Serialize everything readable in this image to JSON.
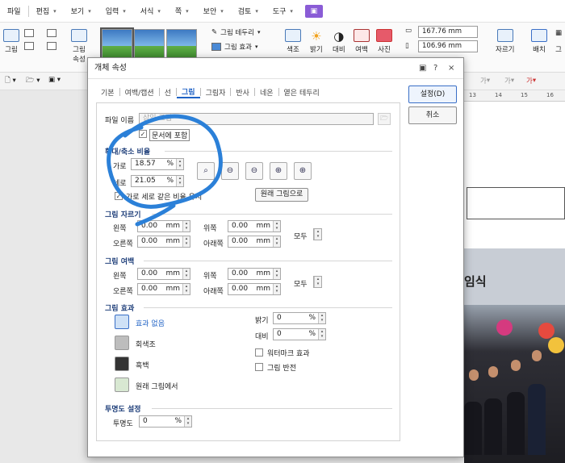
{
  "menubar": {
    "items": [
      "파일",
      "편집",
      "보기",
      "입력",
      "서식",
      "쪽",
      "보안",
      "검토",
      "도구"
    ]
  },
  "ribbon": {
    "picture_label": "그림",
    "picture_label2": "그림",
    "picture_label2_line2": "속성",
    "border_label": "그림 테두리",
    "effect_label": "그림 효과",
    "color_label": "색조",
    "brightness_label": "밝기",
    "contrast_label": "대비",
    "margin_label": "여백",
    "photo_label": "사진",
    "width_value": "167.76",
    "height_value": "106.96",
    "unit": "mm",
    "crop_label": "자르기",
    "arrange_label": "배치",
    "extra_label": "그"
  },
  "toolbar2": {
    "font_label": "가",
    "font_label2": "가",
    "font_label3": "가"
  },
  "doc": {
    "ruler": [
      "13",
      "14",
      "15",
      "16"
    ],
    "photo_title": "임식"
  },
  "dialog": {
    "title": "개체 속성",
    "help": "?",
    "close": "×",
    "tabs": [
      "기본",
      "여백/캡션",
      "선",
      "그림",
      "그림자",
      "반사",
      "네온",
      "옅은 테두리"
    ],
    "active_tab": "그림",
    "set_button": "설정(D)",
    "cancel_button": "취소",
    "file_name_label": "파일 이름",
    "file_name_value": "삽입 그림",
    "include_in_doc": "문서에 포함",
    "scale_section": "확대/축소 비율",
    "width_label": "가로",
    "width_value": "18.57",
    "height_label": "세로",
    "height_value": "21.05",
    "percent": "%",
    "keep_ratio": "가로 세로 같은 비율 유지",
    "original_button": "원래 그림으로",
    "zoom_buttons": [
      "100",
      "1/2",
      "4/5",
      "x2",
      "x4"
    ],
    "crop_section": "그림 자르기",
    "margin_section": "그림 여백",
    "left_label": "왼쪽",
    "top_label": "위쪽",
    "right_label": "오른쪽",
    "bottom_label": "아래쪽",
    "all_label": "모두",
    "mm": "mm",
    "zero": "0.00",
    "effect_section": "그림 효과",
    "effects": [
      "효과 없음",
      "회색조",
      "흑백",
      "원래 그림에서"
    ],
    "brightness_label": "밝기",
    "contrast_label": "대비",
    "brightness_value": "0",
    "contrast_value": "0",
    "watermark": "워터마크 효과",
    "invert": "그림 반전",
    "transparency_section": "투명도 설정",
    "transparency_label": "투명도",
    "transparency_value": "0"
  }
}
